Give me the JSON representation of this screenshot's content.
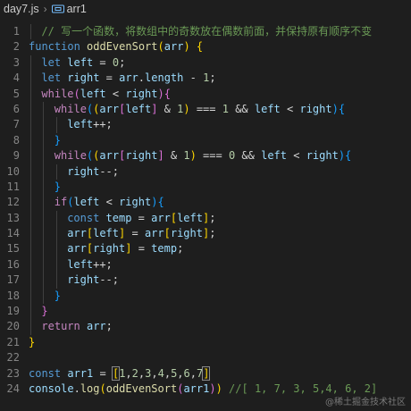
{
  "breadcrumb": {
    "file": "day7.js",
    "symbol": "arr1"
  },
  "lines": [
    {
      "no": "1",
      "indent": 1,
      "tokens": [
        {
          "t": "// 写一个函数，将数组中的奇数放在偶数前面，并保持原有顺序不变",
          "c": "c"
        }
      ]
    },
    {
      "no": "2",
      "indent": 0,
      "tokens": [
        {
          "t": "function ",
          "c": "k"
        },
        {
          "t": "oddEvenSort",
          "c": "f"
        },
        {
          "t": "(",
          "c": "b1"
        },
        {
          "t": "arr",
          "c": "v"
        },
        {
          "t": ") ",
          "c": "b1"
        },
        {
          "t": "{",
          "c": "b1"
        }
      ]
    },
    {
      "no": "3",
      "indent": 1,
      "tokens": [
        {
          "t": "let ",
          "c": "k"
        },
        {
          "t": "left",
          "c": "v"
        },
        {
          "t": " = ",
          "c": "p"
        },
        {
          "t": "0",
          "c": "n"
        },
        {
          "t": ";",
          "c": "p"
        }
      ]
    },
    {
      "no": "4",
      "indent": 1,
      "tokens": [
        {
          "t": "let ",
          "c": "k"
        },
        {
          "t": "right",
          "c": "v"
        },
        {
          "t": " = ",
          "c": "p"
        },
        {
          "t": "arr",
          "c": "v"
        },
        {
          "t": ".",
          "c": "p"
        },
        {
          "t": "length",
          "c": "v"
        },
        {
          "t": " - ",
          "c": "p"
        },
        {
          "t": "1",
          "c": "n"
        },
        {
          "t": ";",
          "c": "p"
        }
      ]
    },
    {
      "no": "5",
      "indent": 1,
      "tokens": [
        {
          "t": "while",
          "c": "kc"
        },
        {
          "t": "(",
          "c": "b2"
        },
        {
          "t": "left",
          "c": "v"
        },
        {
          "t": " < ",
          "c": "p"
        },
        {
          "t": "right",
          "c": "v"
        },
        {
          "t": ")",
          "c": "b2"
        },
        {
          "t": "{",
          "c": "b2"
        }
      ]
    },
    {
      "no": "6",
      "indent": 2,
      "tokens": [
        {
          "t": "while",
          "c": "kc"
        },
        {
          "t": "(",
          "c": "b3"
        },
        {
          "t": "(",
          "c": "b1"
        },
        {
          "t": "arr",
          "c": "v"
        },
        {
          "t": "[",
          "c": "b2"
        },
        {
          "t": "left",
          "c": "v"
        },
        {
          "t": "]",
          "c": "b2"
        },
        {
          "t": " & ",
          "c": "p"
        },
        {
          "t": "1",
          "c": "n"
        },
        {
          "t": ")",
          "c": "b1"
        },
        {
          "t": " === ",
          "c": "p"
        },
        {
          "t": "1",
          "c": "n"
        },
        {
          "t": " && ",
          "c": "p"
        },
        {
          "t": "left",
          "c": "v"
        },
        {
          "t": " < ",
          "c": "p"
        },
        {
          "t": "right",
          "c": "v"
        },
        {
          "t": ")",
          "c": "b3"
        },
        {
          "t": "{",
          "c": "b3"
        }
      ]
    },
    {
      "no": "7",
      "indent": 3,
      "tokens": [
        {
          "t": "left",
          "c": "v"
        },
        {
          "t": "++;",
          "c": "p"
        }
      ]
    },
    {
      "no": "8",
      "indent": 2,
      "tokens": [
        {
          "t": "}",
          "c": "b3"
        }
      ]
    },
    {
      "no": "9",
      "indent": 2,
      "tokens": [
        {
          "t": "while",
          "c": "kc"
        },
        {
          "t": "(",
          "c": "b3"
        },
        {
          "t": "(",
          "c": "b1"
        },
        {
          "t": "arr",
          "c": "v"
        },
        {
          "t": "[",
          "c": "b2"
        },
        {
          "t": "right",
          "c": "v"
        },
        {
          "t": "]",
          "c": "b2"
        },
        {
          "t": " & ",
          "c": "p"
        },
        {
          "t": "1",
          "c": "n"
        },
        {
          "t": ")",
          "c": "b1"
        },
        {
          "t": " === ",
          "c": "p"
        },
        {
          "t": "0",
          "c": "n"
        },
        {
          "t": " && ",
          "c": "p"
        },
        {
          "t": "left",
          "c": "v"
        },
        {
          "t": " < ",
          "c": "p"
        },
        {
          "t": "right",
          "c": "v"
        },
        {
          "t": ")",
          "c": "b3"
        },
        {
          "t": "{",
          "c": "b3"
        }
      ]
    },
    {
      "no": "10",
      "indent": 3,
      "tokens": [
        {
          "t": "right",
          "c": "v"
        },
        {
          "t": "--;",
          "c": "p"
        }
      ]
    },
    {
      "no": "11",
      "indent": 2,
      "tokens": [
        {
          "t": "}",
          "c": "b3"
        }
      ]
    },
    {
      "no": "12",
      "indent": 2,
      "tokens": [
        {
          "t": "if",
          "c": "kc"
        },
        {
          "t": "(",
          "c": "b3"
        },
        {
          "t": "left",
          "c": "v"
        },
        {
          "t": " < ",
          "c": "p"
        },
        {
          "t": "right",
          "c": "v"
        },
        {
          "t": ")",
          "c": "b3"
        },
        {
          "t": "{",
          "c": "b3"
        }
      ]
    },
    {
      "no": "13",
      "indent": 3,
      "tokens": [
        {
          "t": "const ",
          "c": "k"
        },
        {
          "t": "temp",
          "c": "v"
        },
        {
          "t": " = ",
          "c": "p"
        },
        {
          "t": "arr",
          "c": "v"
        },
        {
          "t": "[",
          "c": "b1"
        },
        {
          "t": "left",
          "c": "v"
        },
        {
          "t": "]",
          "c": "b1"
        },
        {
          "t": ";",
          "c": "p"
        }
      ]
    },
    {
      "no": "14",
      "indent": 3,
      "tokens": [
        {
          "t": "arr",
          "c": "v"
        },
        {
          "t": "[",
          "c": "b1"
        },
        {
          "t": "left",
          "c": "v"
        },
        {
          "t": "]",
          "c": "b1"
        },
        {
          "t": " = ",
          "c": "p"
        },
        {
          "t": "arr",
          "c": "v"
        },
        {
          "t": "[",
          "c": "b1"
        },
        {
          "t": "right",
          "c": "v"
        },
        {
          "t": "]",
          "c": "b1"
        },
        {
          "t": ";",
          "c": "p"
        }
      ]
    },
    {
      "no": "15",
      "indent": 3,
      "tokens": [
        {
          "t": "arr",
          "c": "v"
        },
        {
          "t": "[",
          "c": "b1"
        },
        {
          "t": "right",
          "c": "v"
        },
        {
          "t": "]",
          "c": "b1"
        },
        {
          "t": " = ",
          "c": "p"
        },
        {
          "t": "temp",
          "c": "v"
        },
        {
          "t": ";",
          "c": "p"
        }
      ]
    },
    {
      "no": "16",
      "indent": 3,
      "tokens": [
        {
          "t": "left",
          "c": "v"
        },
        {
          "t": "++;",
          "c": "p"
        }
      ]
    },
    {
      "no": "17",
      "indent": 3,
      "tokens": [
        {
          "t": "right",
          "c": "v"
        },
        {
          "t": "--;",
          "c": "p"
        }
      ]
    },
    {
      "no": "18",
      "indent": 2,
      "tokens": [
        {
          "t": "}",
          "c": "b3"
        }
      ]
    },
    {
      "no": "19",
      "indent": 1,
      "tokens": [
        {
          "t": "}",
          "c": "b2"
        }
      ]
    },
    {
      "no": "20",
      "indent": 1,
      "tokens": [
        {
          "t": "return ",
          "c": "kc"
        },
        {
          "t": "arr",
          "c": "v"
        },
        {
          "t": ";",
          "c": "p"
        }
      ]
    },
    {
      "no": "21",
      "indent": 0,
      "tokens": [
        {
          "t": "}",
          "c": "b1"
        }
      ]
    },
    {
      "no": "22",
      "indent": 0,
      "tokens": []
    },
    {
      "no": "23",
      "indent": 0,
      "tokens": [
        {
          "t": "const ",
          "c": "k"
        },
        {
          "t": "arr1",
          "c": "v"
        },
        {
          "t": " = ",
          "c": "p"
        },
        {
          "t": "[",
          "c": "b1 bm"
        },
        {
          "t": "1",
          "c": "n"
        },
        {
          "t": ",",
          "c": "p"
        },
        {
          "t": "2",
          "c": "n"
        },
        {
          "t": ",",
          "c": "p"
        },
        {
          "t": "3",
          "c": "n"
        },
        {
          "t": ",",
          "c": "p"
        },
        {
          "t": "4",
          "c": "n"
        },
        {
          "t": ",",
          "c": "p"
        },
        {
          "t": "5",
          "c": "n"
        },
        {
          "t": ",",
          "c": "p"
        },
        {
          "t": "6",
          "c": "n"
        },
        {
          "t": ",",
          "c": "p"
        },
        {
          "t": "7",
          "c": "n"
        },
        {
          "t": "]",
          "c": "b1 bm"
        },
        {
          "t": "",
          "c": "cursor"
        }
      ]
    },
    {
      "no": "24",
      "indent": 0,
      "tokens": [
        {
          "t": "console",
          "c": "v"
        },
        {
          "t": ".",
          "c": "p"
        },
        {
          "t": "log",
          "c": "f"
        },
        {
          "t": "(",
          "c": "b1"
        },
        {
          "t": "oddEvenSort",
          "c": "f"
        },
        {
          "t": "(",
          "c": "b2"
        },
        {
          "t": "arr1",
          "c": "v"
        },
        {
          "t": ")",
          "c": "b2"
        },
        {
          "t": ")",
          "c": "b1"
        },
        {
          "t": " //[ 1, 7, 3, 5,4, 6, 2]",
          "c": "c"
        }
      ]
    }
  ],
  "watermark": "@稀土掘金技术社区"
}
